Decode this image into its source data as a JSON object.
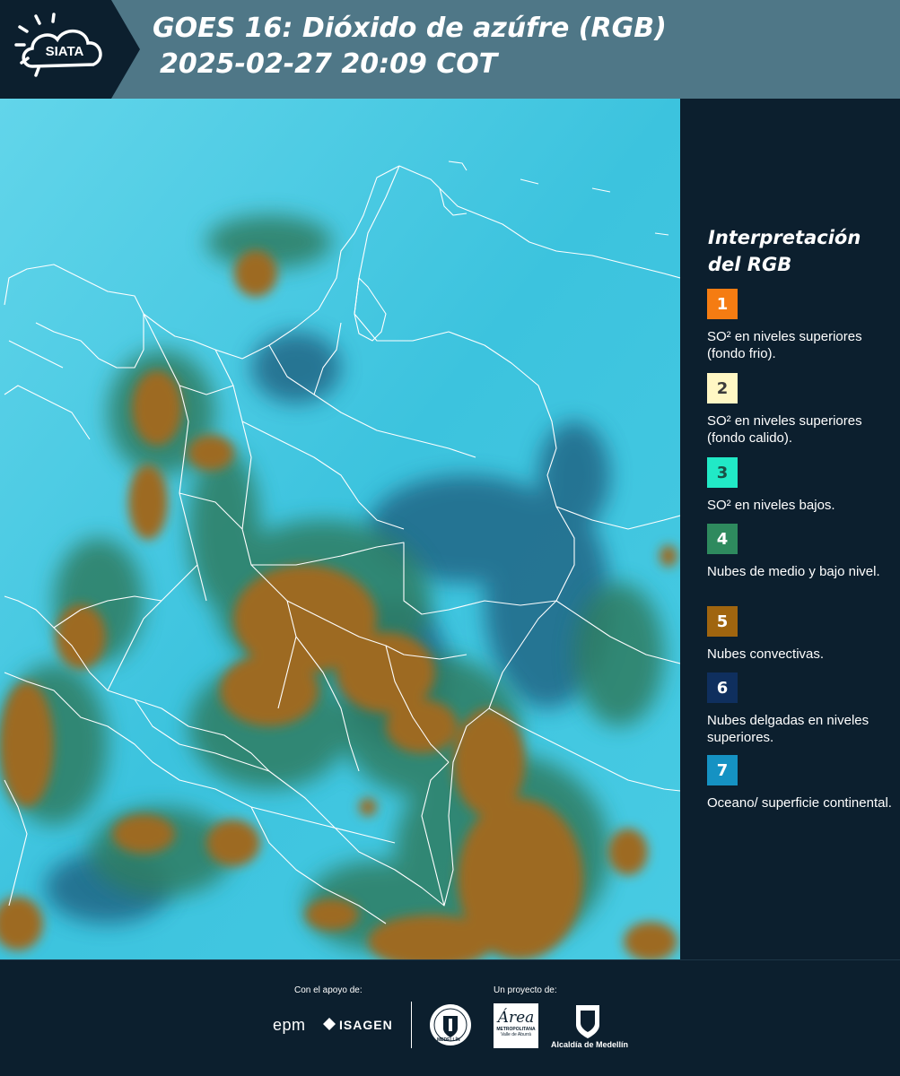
{
  "header": {
    "logo_text": "SIATA",
    "title_line1": "GOES 16: Dióxido de azúfre (RGB)",
    "title_line2": "2025-02-27 20:09 COT",
    "background_color": "#4f7787"
  },
  "legend": {
    "title": "Interpretación del RGB",
    "items": [
      {
        "number": "1",
        "text": "SO² en niveles superiores (fondo frio).",
        "color": "#f57c12",
        "number_color": "#ffffff"
      },
      {
        "number": "2",
        "text": "SO² en niveles superiores (fondo calido).",
        "color": "#fff7c4",
        "number_color": "#3b3b3b"
      },
      {
        "number": "3",
        "text": "SO² en niveles bajos.",
        "color": "#21e9c6",
        "number_color": "#1a4f45"
      },
      {
        "number": "4",
        "text": "Nubes de medio y bajo nivel.",
        "color": "#2e8a5e",
        "number_color": "#ffffff"
      },
      {
        "number": "5",
        "text": "Nubes convectivas.",
        "color": "#a0650f",
        "number_color": "#ffffff"
      },
      {
        "number": "6",
        "text": "Nubes delgadas en niveles superiores.",
        "color": "#0f2f5e",
        "number_color": "#ffffff"
      },
      {
        "number": "7",
        "text": "Oceano/ superficie continental.",
        "color": "#1592c3",
        "number_color": "#ffffff"
      }
    ]
  },
  "footer": {
    "support_label": "Con el apoyo de:",
    "project_label": "Un proyecto de:",
    "sponsor_1": "epm",
    "sponsor_2": "ISAGEN",
    "partner_1_caption": "MEDELLÍN",
    "partner_2_word": "Área",
    "partner_2_caption": "METROPOLITANA",
    "partner_2_subcaption": "Valle de Aburrá",
    "partner_3_caption": "Alcaldía de Medellín"
  },
  "map": {
    "icons": [
      "siata-sun-cloud-logo"
    ],
    "colors": {
      "background": "#3ec6e0",
      "convective": "#9d6a22",
      "mid_low": "#2d7d62",
      "thin_high": "#1f5a7a",
      "borders": "#ffffff"
    }
  }
}
